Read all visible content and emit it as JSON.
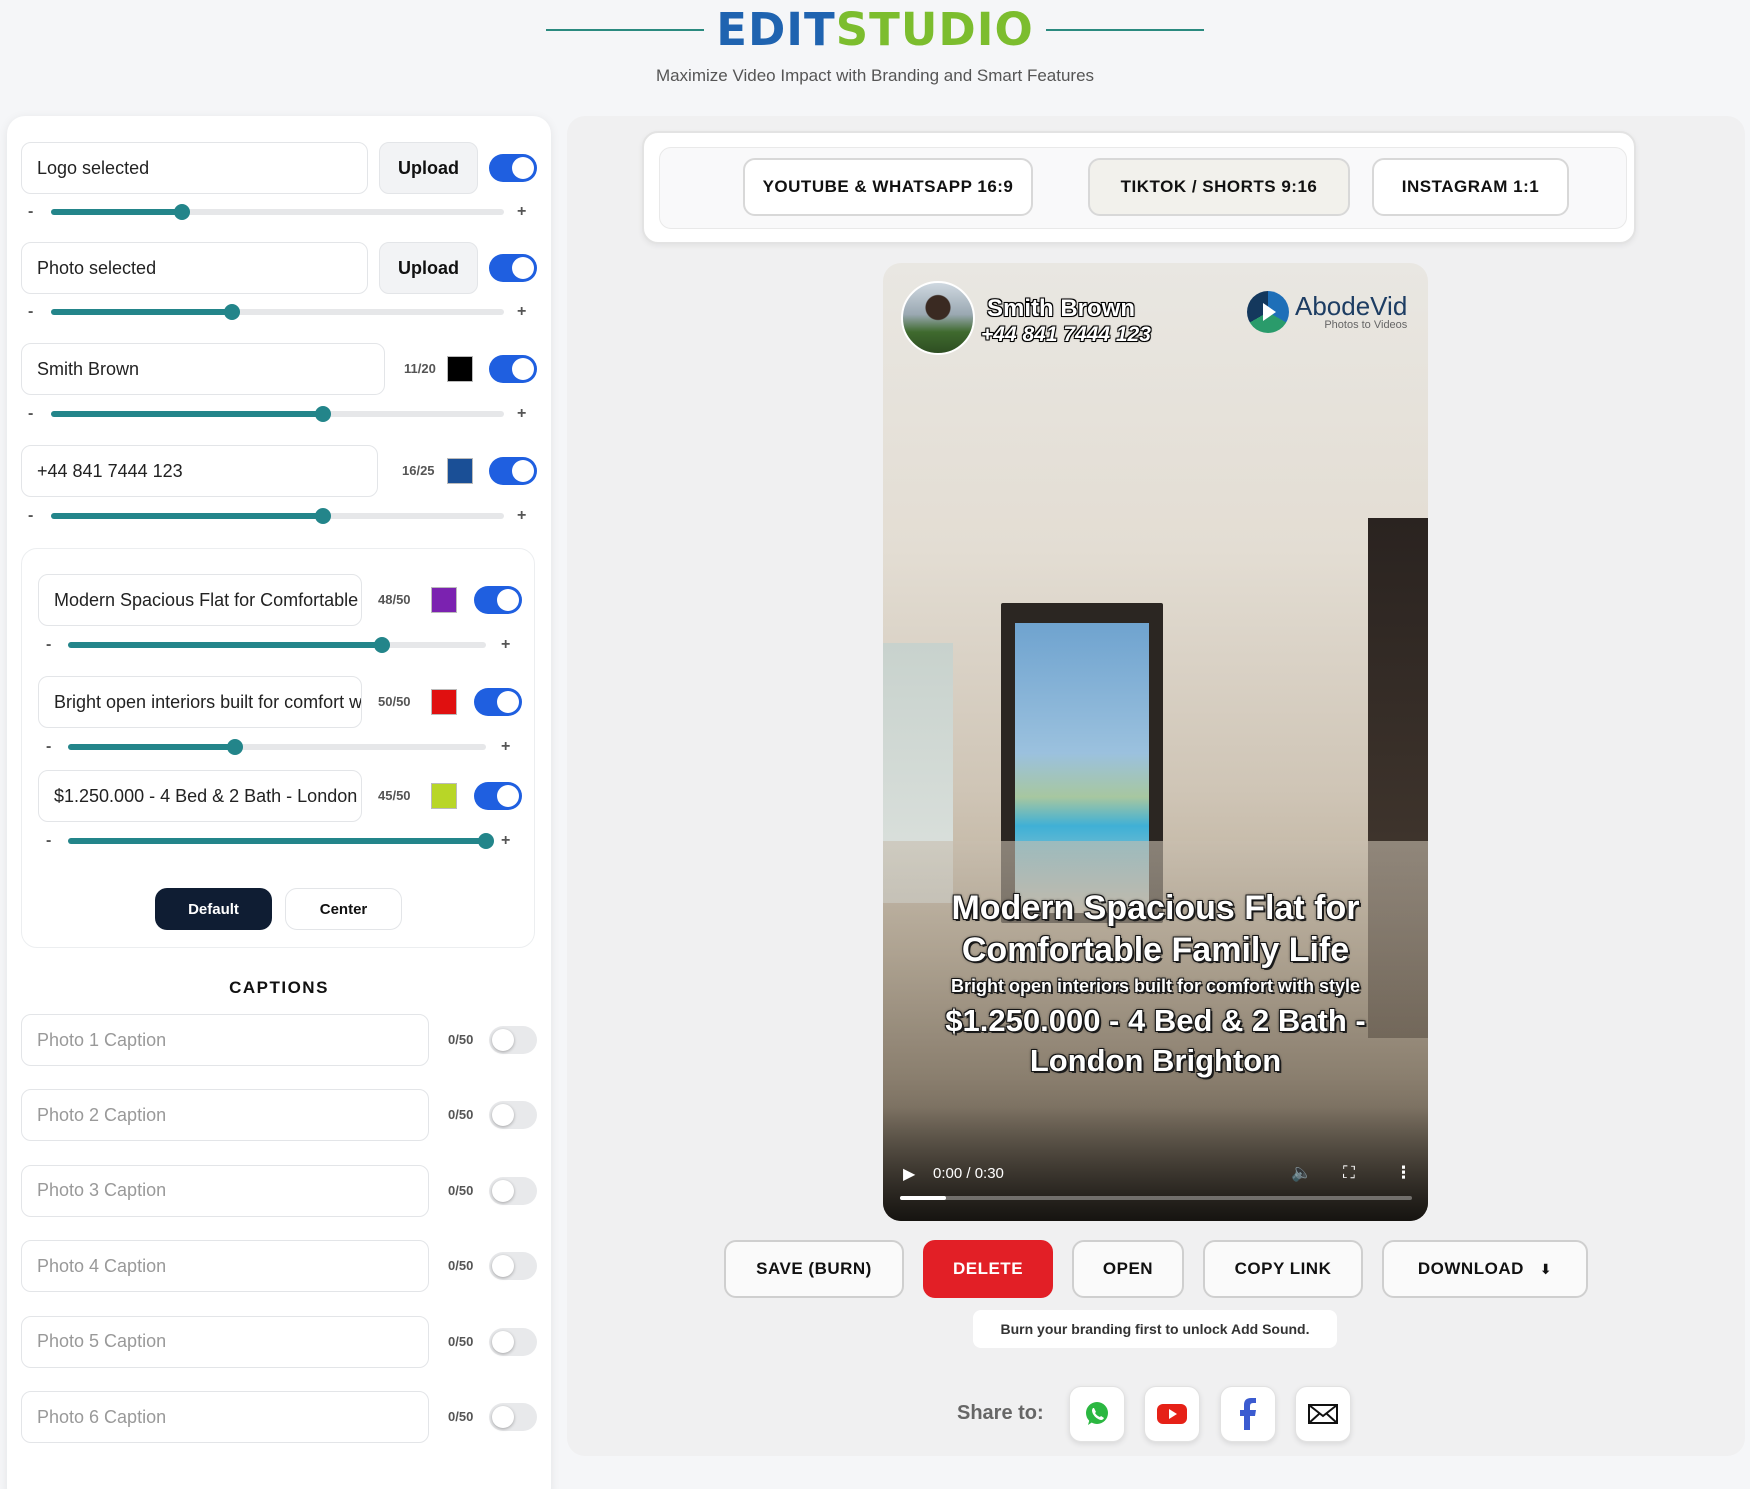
{
  "header": {
    "brand_part1": "EDIT",
    "brand_part2": "STUDIO",
    "subtitle": "Maximize Video Impact with Branding and Smart Features"
  },
  "branding": {
    "logo": {
      "value": "Logo selected",
      "upload_label": "Upload",
      "enabled": true,
      "size": 0.29
    },
    "photo": {
      "value": "Photo selected",
      "upload_label": "Upload",
      "enabled": true,
      "size": 0.4
    },
    "name": {
      "value": "Smith Brown",
      "count": "11/20",
      "color": "#000000",
      "enabled": true,
      "size": 0.6
    },
    "phone": {
      "value": "+44 841 7444 123",
      "count": "16/25",
      "color": "#1a4f96",
      "enabled": true,
      "size": 0.6
    }
  },
  "texts": [
    {
      "value": "Modern Spacious Flat for Comfortable Family Life",
      "count": "48/50",
      "color": "#7b22b0",
      "enabled": true,
      "size": 0.75
    },
    {
      "value": "Bright open interiors built for comfort with style",
      "count": "50/50",
      "color": "#e01010",
      "enabled": true,
      "size": 0.4
    },
    {
      "value": "$1.250.000 - 4 Bed & 2 Bath - London Brighton",
      "count": "45/50",
      "color": "#b8d627",
      "enabled": true,
      "size": 1.0
    }
  ],
  "slider_minus": "-",
  "slider_plus": "+",
  "position": {
    "default_label": "Default",
    "center_label": "Center",
    "selected": "Default"
  },
  "captions": {
    "title": "CAPTIONS",
    "items": [
      {
        "placeholder": "Photo 1 Caption",
        "count": "0/50",
        "enabled": false
      },
      {
        "placeholder": "Photo 2 Caption",
        "count": "0/50",
        "enabled": false
      },
      {
        "placeholder": "Photo 3 Caption",
        "count": "0/50",
        "enabled": false
      },
      {
        "placeholder": "Photo 4 Caption",
        "count": "0/50",
        "enabled": false
      },
      {
        "placeholder": "Photo 5 Caption",
        "count": "0/50",
        "enabled": false
      },
      {
        "placeholder": "Photo 6 Caption",
        "count": "0/50",
        "enabled": false
      }
    ]
  },
  "formats": [
    {
      "label": "YOUTUBE & WHATSAPP 16:9",
      "active": false
    },
    {
      "label": "TIKTOK / SHORTS 9:16",
      "active": true
    },
    {
      "label": "INSTAGRAM 1:1",
      "active": false
    }
  ],
  "video": {
    "overlay_name": "Smith Brown",
    "overlay_phone": "+44 841 7444 123",
    "logo_name": "AbodeVid",
    "logo_tagline": "Photos to Videos",
    "title_line1": "Modern Spacious Flat for",
    "title_line2": "Comfortable Family Life",
    "subtitle": "Bright open interiors built for comfort with style",
    "price_line1": "$1.250.000 - 4 Bed & 2 Bath -",
    "price_line2": "London Brighton",
    "time": "0:00 / 0:30",
    "progress": 0.09,
    "icons": [
      "play-icon",
      "mute-icon",
      "fullscreen-icon",
      "more-icon"
    ]
  },
  "actions": {
    "save": "SAVE (BURN)",
    "delete": "DELETE",
    "open": "OPEN",
    "copy": "COPY LINK",
    "download": "DOWNLOAD",
    "download_icon": "⬇"
  },
  "notice": "Burn your branding first to unlock Add Sound.",
  "share": {
    "label": "Share to:",
    "targets": [
      "whatsapp-icon",
      "youtube-icon",
      "facebook-icon",
      "email-icon"
    ]
  },
  "colors": {
    "brand_blue": "#1f63b0",
    "brand_green": "#7cbd2e",
    "toggle_on": "#1f5fe0",
    "slider": "#23858a",
    "danger": "#e21f26"
  }
}
